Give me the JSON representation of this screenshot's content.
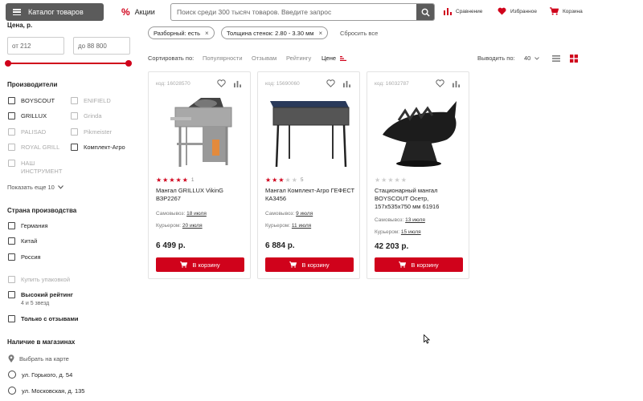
{
  "header": {
    "catalog_label": "Каталог товаров",
    "promo_label": "Акции",
    "search_placeholder": "Поиск среди 300 тысяч товаров. Введите запрос",
    "compare_label": "Сравнение",
    "favorites_label": "Избранное",
    "cart_label": "Корзина"
  },
  "sidebar": {
    "price_title": "Цена, р.",
    "price_from": "от 212",
    "price_to": "до 88 800",
    "manufacturers_title": "Производители",
    "manufacturers": [
      {
        "label": "BOYSCOUT",
        "enabled": true
      },
      {
        "label": "ENIFIELD",
        "enabled": false
      },
      {
        "label": "GRILLUX",
        "enabled": true
      },
      {
        "label": "Grinda",
        "enabled": false
      },
      {
        "label": "PALISAD",
        "enabled": false
      },
      {
        "label": "Pikmeister",
        "enabled": false
      },
      {
        "label": "ROYAL GRILL",
        "enabled": false
      },
      {
        "label": "Комплект-Агро",
        "enabled": true
      },
      {
        "label": "НАШ ИНСТРУМЕНТ",
        "enabled": false
      }
    ],
    "show_more": "Показать еще 10",
    "country_title": "Страна производства",
    "countries": [
      "Германия",
      "Китай",
      "Россия"
    ],
    "pack_label": "Купить упаковкой",
    "high_rating_label": "Высокий рейтинг",
    "high_rating_sub": "4 и 5 звезд",
    "reviews_only_label": "Только с отзывами",
    "stores_title": "Наличие в магазинах",
    "map_link": "Выбрать на карте",
    "stores": [
      "ул. Горького, д. 54",
      "ул. Московская, д. 135"
    ]
  },
  "filters": {
    "chips": [
      "Разборный: есть",
      "Толщина стенок: 2.80 - 3.30 мм"
    ],
    "reset_label": "Сбросить все"
  },
  "sort": {
    "label": "Сортировать по:",
    "options": [
      "Популярности",
      "Отзывам",
      "Рейтингу",
      "Цене"
    ],
    "active": "Цене",
    "per_page_label": "Выводить по:",
    "per_page_value": "40"
  },
  "products": [
    {
      "code": "код: 16028570",
      "rating": 5,
      "reviews": "1",
      "name": "Мангал GRILLUX VikinG ВЗР2267",
      "pickup_label": "Самовывоз:",
      "pickup_date": "18 июля",
      "courier_label": "Курьером:",
      "courier_date": "20 июля",
      "price": "6 499 р.",
      "cart_label": "В корзину",
      "image": "square-grill-icon"
    },
    {
      "code": "код: 15690060",
      "rating": 3,
      "reviews": "5",
      "name": "Мангал Комплект-Агро ГЕФЕСТ КА3456",
      "pickup_label": "Самовывоз:",
      "pickup_date": "9 июля",
      "courier_label": "Курьером:",
      "courier_date": "11 июля",
      "price": "6 884 р.",
      "cart_label": "В корзину",
      "image": "long-grill-icon"
    },
    {
      "code": "код: 16032787",
      "rating": 0,
      "reviews": "",
      "name": "Стационарный мангал BOYSCOUT Осетр, 157x535x750 мм 61916",
      "pickup_label": "Самовывоз:",
      "pickup_date": "13 июля",
      "courier_label": "Курьером:",
      "courier_date": "15 июля",
      "price": "42 203 р.",
      "cart_label": "В корзину",
      "image": "sturgeon-grill-icon"
    }
  ],
  "colors": {
    "accent": "#d0021b",
    "dark": "#5b5b5b"
  }
}
